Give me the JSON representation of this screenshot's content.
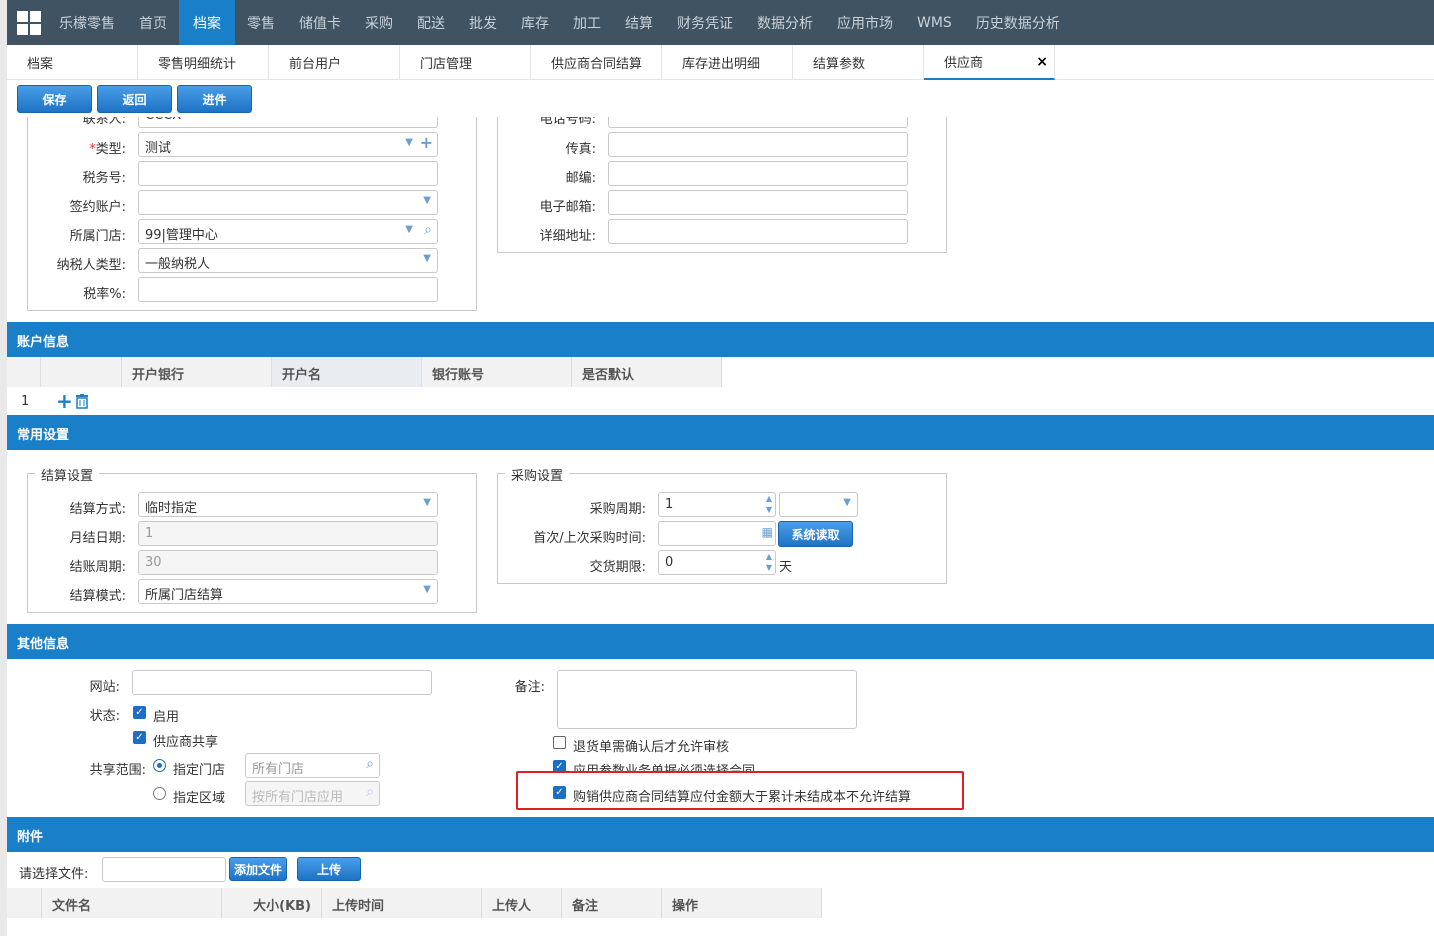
{
  "nav": {
    "items": [
      "乐檬零售",
      "首页",
      "档案",
      "零售",
      "储值卡",
      "采购",
      "配送",
      "批发",
      "库存",
      "加工",
      "结算",
      "财务凭证",
      "数据分析",
      "应用市场",
      "WMS",
      "历史数据分析"
    ],
    "active_index": 2
  },
  "tabs": {
    "items": [
      "档案",
      "零售明细统计",
      "前台用户",
      "门店管理",
      "供应商合同结算",
      "库存进出明细",
      "结算参数",
      "供应商"
    ],
    "active_index": 7,
    "close": "×"
  },
  "toolbar": {
    "save": "保存",
    "back": "返回",
    "purchase": "进件"
  },
  "basic": {
    "contact_label": "联系人:",
    "contact_value": "CCCX",
    "type_label": "类型:",
    "type_required": "*",
    "type_value": "测试",
    "tax_no_label": "税务号:",
    "sign_account_label": "签约账户:",
    "store_label": "所属门店:",
    "store_value": "99|管理中心",
    "taxpayer_label": "纳税人类型:",
    "taxpayer_value": "一般纳税人",
    "tax_rate_label": "税率%:",
    "phone_label": "电话号码:",
    "fax_label": "传真:",
    "zip_label": "邮编:",
    "email_label": "电子邮箱:",
    "address_label": "详细地址:"
  },
  "account_section": {
    "title": "账户信息",
    "columns": [
      "开户银行",
      "开户名",
      "银行账号",
      "是否默认"
    ],
    "row_number": "1"
  },
  "common_section": {
    "title": "常用设置",
    "settle_legend": "结算设置",
    "settle_method_label": "结算方式:",
    "settle_method_value": "临时指定",
    "month_day_label": "月结日期:",
    "month_day_value": "1",
    "period_label": "结账周期:",
    "period_value": "30",
    "mode_label": "结算模式:",
    "mode_value": "所属门店结算",
    "purchase_legend": "采购设置",
    "purchase_cycle_label": "采购周期:",
    "purchase_cycle_value": "1",
    "first_last_label": "首次/上次采购时间:",
    "system_read": "系统读取",
    "delivery_label": "交货期限:",
    "delivery_value": "0",
    "delivery_unit": "天"
  },
  "other_section": {
    "title": "其他信息",
    "website_label": "网站:",
    "status_label": "状态:",
    "enabled": "启用",
    "enabled_checked": true,
    "shared_supplier": "供应商共享",
    "shared_checked": true,
    "share_scope_label": "共享范围:",
    "specified_store": "指定门店",
    "specified_store_checked": true,
    "store_placeholder": "所有门店",
    "specified_area": "指定区域",
    "specified_area_checked": false,
    "area_placeholder": "按所有门店应用",
    "remark_label": "备注:",
    "opt1": "退货单需确认后才允许审核",
    "opt1_checked": false,
    "opt2": "应用参数业务单据必须选择合同",
    "opt2_checked": true,
    "opt3": "购销供应商合同结算应付金额大于累计未结成本不允许结算",
    "opt3_checked": true,
    "highlight_color": "#e02020"
  },
  "attach_section": {
    "title": "附件",
    "choose_label": "请选择文件:",
    "add_file": "添加文件",
    "upload": "上传",
    "columns": [
      "文件名",
      "大小(KB)",
      "上传时间",
      "上传人",
      "备注",
      "操作"
    ]
  }
}
